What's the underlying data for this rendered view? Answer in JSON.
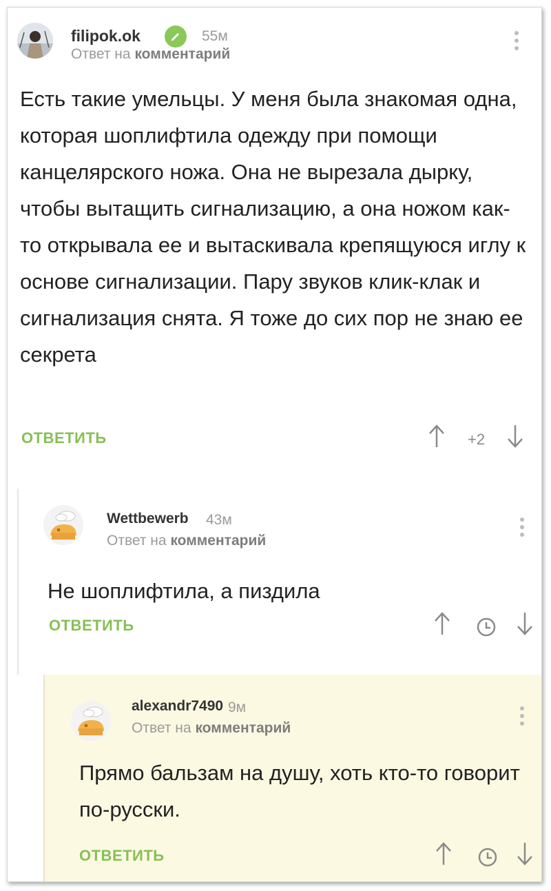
{
  "comments": [
    {
      "username": "filipok.ok",
      "time": "55м",
      "reply_prefix": "Ответ на",
      "reply_target": "комментарий",
      "text": "Есть такие умельцы. У меня была знакомая одна, которая шоплифтила одежду при помощи канцелярского ножа. Она не вырезала дырку, чтобы вытащить сигнализацию, а она ножом как-то открывала ее и вытаскивала крепящуюся иглу к основе сигнализации. Пару звуков клик-клак и сигнализация снята. Я тоже до сих пор не знаю ее секрета",
      "reply_label": "ОТВЕТИТЬ",
      "rating": "+2"
    },
    {
      "username": "Wettbewerb",
      "time": "43м",
      "reply_prefix": "Ответ на",
      "reply_target": "комментарий",
      "text": "Не шоплифтила, а пиздила",
      "reply_label": "ОТВЕТИТЬ"
    },
    {
      "username": "alexandr7490",
      "time": "9м",
      "reply_prefix": "Ответ на",
      "reply_target": "комментарий",
      "text": "Прямо бальзам на душу, хоть кто-то говорит по-русски.",
      "reply_label": "ОТВЕТИТЬ"
    }
  ],
  "colors": {
    "accent": "#86c055",
    "badge": "#8ac858",
    "muted": "#9a9a9a",
    "highlight_bg": "#fcf9e3"
  },
  "icons": [
    "verified-icon",
    "more-icon",
    "upvote-icon",
    "downvote-icon",
    "clock-icon"
  ]
}
